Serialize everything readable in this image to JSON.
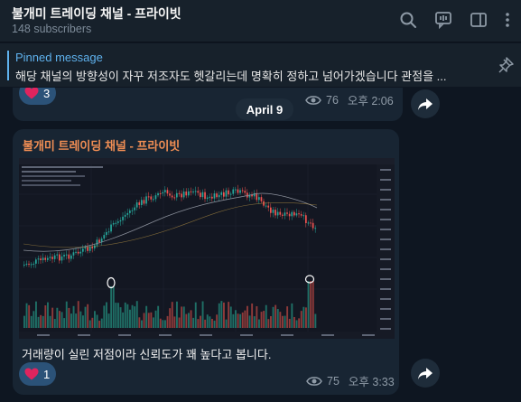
{
  "header": {
    "title": "불개미 트레이딩 채널 - 프라이빗",
    "subtitle": "148 subscribers",
    "icons": [
      "search-icon",
      "discussion-icon",
      "sidebar-toggle-icon",
      "more-icon"
    ]
  },
  "pinned": {
    "title": "Pinned message",
    "text": "해당 채널의 방향성이 자꾸 저조자도 헷갈리는데 명확히 정하고 넘어가겠습니다   관점을 ..."
  },
  "messages": [
    {
      "reaction_count": "3",
      "views": "76",
      "time": "오후 2:06"
    },
    {
      "channel_name": "불개미 트레이딩 채널 - 프라이빗",
      "caption": "거래량이 실린 저점이라 신뢰도가 꽤 높다고 봅니다.",
      "reaction_count": "1",
      "views": "75",
      "time": "오후 3:33"
    }
  ],
  "date_pill": "April 9",
  "colors": {
    "accent": "#5fb2ee",
    "channel_name": "#f08e54",
    "reaction_bg": "#2b5278",
    "heart": "#e0245e"
  }
}
